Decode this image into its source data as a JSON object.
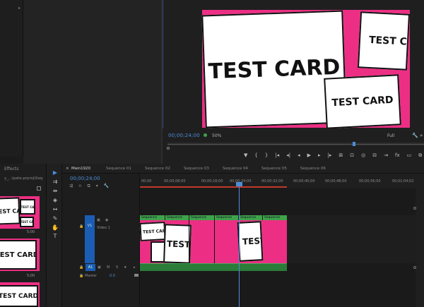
{
  "top_left": {
    "marker": "▸"
  },
  "monitor": {
    "timecode": "00;00;24;00",
    "fit": "50%",
    "quality": "Full",
    "card_text": "TEST CARD",
    "card_text_cut": "TEST CA",
    "controls": [
      "▼",
      "{",
      "}",
      "|◂",
      "◂|",
      "◂",
      "▶",
      "▸",
      "|▸",
      "⊞",
      "⊡",
      "◎",
      "⊟",
      "⇥",
      "fx",
      "▭",
      "⧉"
    ]
  },
  "project_panel": {
    "tab": "Effects",
    "path": "y_...lpate.prproj\\Seq",
    "duration": "5;00",
    "card_text": "TEST CARD",
    "card_text_cut": "TEST CA"
  },
  "tools": [
    {
      "name": "selection-tool",
      "glyph": "▶"
    },
    {
      "name": "track-select-tool",
      "glyph": "⇉"
    },
    {
      "name": "ripple-edit-tool",
      "glyph": "⇹"
    },
    {
      "name": "razor-tool",
      "glyph": "◈"
    },
    {
      "name": "slip-tool",
      "glyph": "↔"
    },
    {
      "name": "pen-tool",
      "glyph": "✎"
    },
    {
      "name": "hand-tool",
      "glyph": "✋"
    },
    {
      "name": "type-tool",
      "glyph": "T"
    }
  ],
  "timeline": {
    "tabs": [
      "Main1920",
      "Sequence 01",
      "Sequence 02",
      "Sequence 03",
      "Sequence 04",
      "Sequence 05",
      "Sequence 06"
    ],
    "timecode": "00;00;24;00",
    "ruler": [
      "00;00",
      "00;00;08;00",
      "00;00;16;00",
      "00;00;24;00",
      "00;00;32;00",
      "00;00;40;00",
      "00;00;48;00",
      "00;00;56;00",
      "00;01;04;02"
    ],
    "video_track": {
      "id": "V1",
      "name": "Video 1"
    },
    "audio_track": {
      "id": "A1",
      "m": "M",
      "s": "S"
    },
    "master": {
      "label": "Master",
      "value": "0.0"
    },
    "clip_label": "Sequence",
    "card_text": "TEST CARD",
    "card_text_cut": "TEST C",
    "card_text_short": "TEST"
  },
  "colors": {
    "accent": "#4b8ed9",
    "pink": "#ec2f84",
    "clip_green": "#3fa349",
    "track_blue": "#1a5db3"
  }
}
